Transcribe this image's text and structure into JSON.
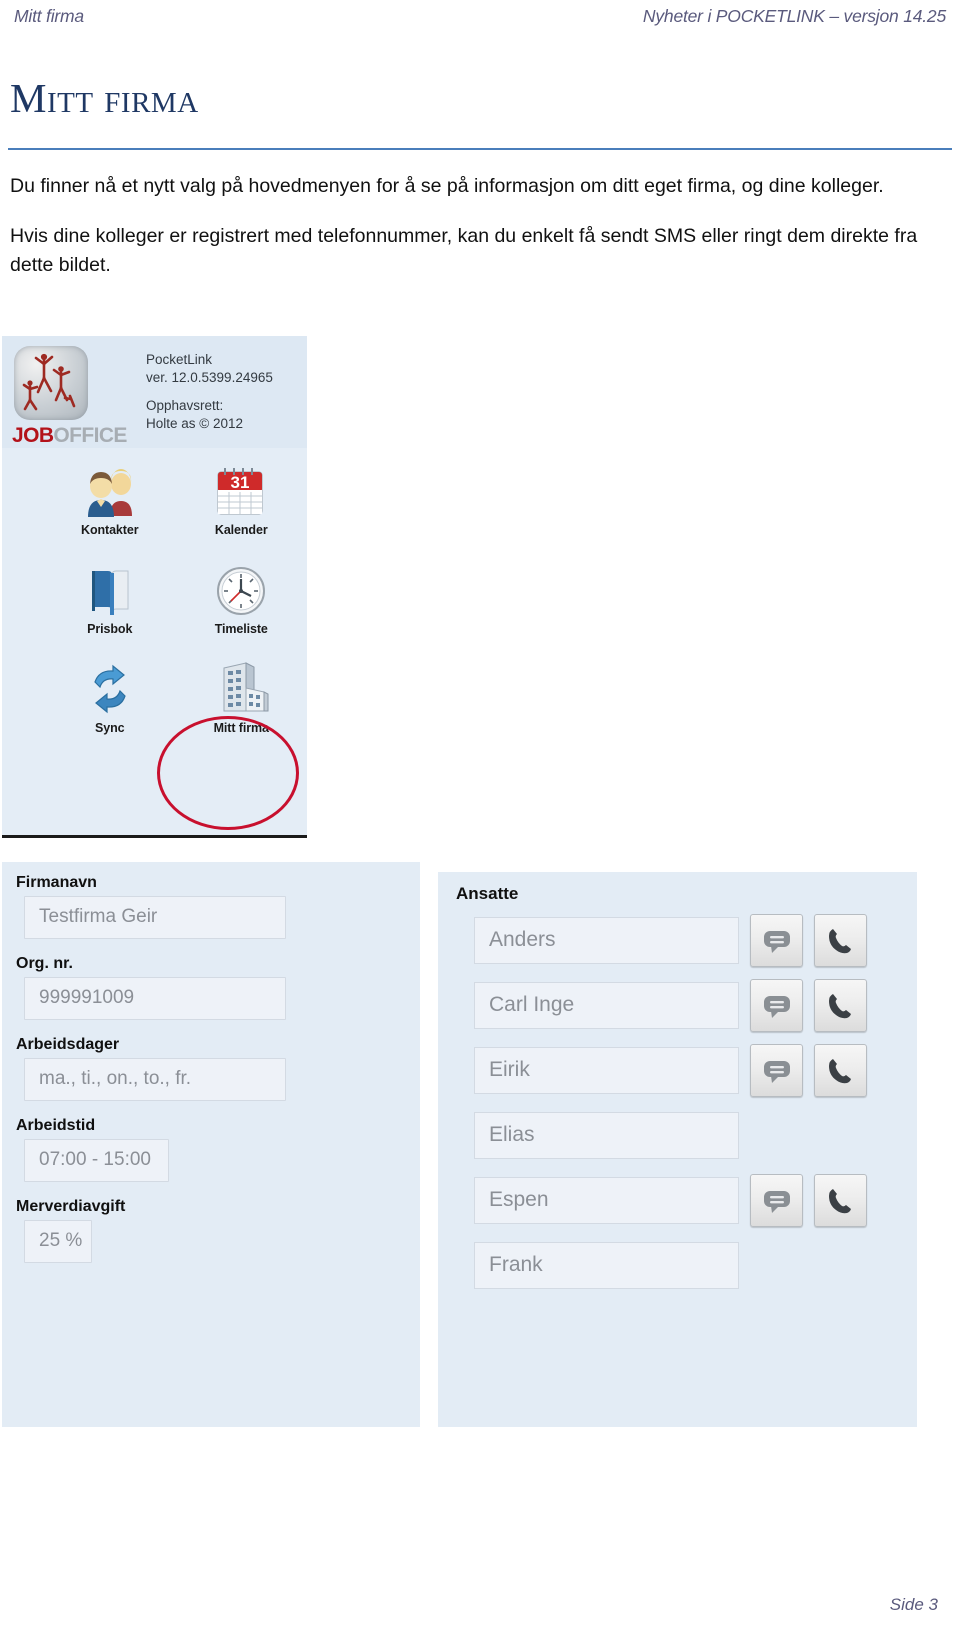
{
  "header": {
    "left": "Mitt firma",
    "right": "Nyheter i POCKETLINK – versjon 14.25"
  },
  "title": "Mitt firma",
  "body": {
    "paragraph1": "Du finner nå et nytt valg på hovedmenyen for å se på informasjon om ditt eget firma, og dine kolleger.",
    "paragraph2": "Hvis dine kolleger er registrert med telefonnummer, kan du enkelt få sendt SMS eller ringt dem direkte fra dette bildet."
  },
  "phone_screenshot": {
    "logo": {
      "part1": "JOB",
      "part2": "OFFICE"
    },
    "app_name": "PocketLink",
    "app_version": "ver. 12.0.5399.24965",
    "copyright_label": "Opphavsrett:",
    "copyright_value": "Holte as © 2012",
    "menu_items": [
      {
        "label": "Kontakter",
        "icon": "contacts-people-icon",
        "highlighted": false
      },
      {
        "label": "Kalender",
        "icon": "calendar-icon",
        "highlighted": false
      },
      {
        "label": "Prisbok",
        "icon": "blue-book-icon",
        "highlighted": false
      },
      {
        "label": "Timeliste",
        "icon": "clock-icon",
        "highlighted": false
      },
      {
        "label": "Sync",
        "icon": "sync-arrows-icon",
        "highlighted": false
      },
      {
        "label": "Mitt firma",
        "icon": "office-building-icon",
        "highlighted": true
      }
    ],
    "calendar_day": "31",
    "highlight_color": "#c8102e"
  },
  "company_panel": {
    "fields": [
      {
        "label": "Firmanavn",
        "value": "Testfirma Geir",
        "size": "wide"
      },
      {
        "label": "Org. nr.",
        "value": "999991009",
        "size": "wide"
      },
      {
        "label": "Arbeidsdager",
        "value": "ma., ti., on., to., fr.",
        "size": "wide"
      },
      {
        "label": "Arbeidstid",
        "value": "07:00 - 15:00",
        "size": "mid"
      },
      {
        "label": "Merverdiavgift",
        "value": "25 %",
        "size": "small"
      }
    ]
  },
  "employee_panel": {
    "title": "Ansatte",
    "sms_icon": "sms-bubble-icon",
    "call_icon": "phone-handset-icon",
    "employees": [
      {
        "name": "Anders",
        "has_actions": true
      },
      {
        "name": "Carl Inge",
        "has_actions": true
      },
      {
        "name": "Eirik",
        "has_actions": true
      },
      {
        "name": "Elias",
        "has_actions": false
      },
      {
        "name": "Espen",
        "has_actions": true
      },
      {
        "name": "Frank",
        "has_actions": false
      }
    ]
  },
  "footer": {
    "page": "Side 3"
  },
  "colors": {
    "title": "#1f3864",
    "rule": "#4a7ebb",
    "panel_bg": "#e3ecf5",
    "field_bg": "#eef2f8",
    "header_text": "#5a5a7d",
    "logo_red": "#b3121a"
  }
}
